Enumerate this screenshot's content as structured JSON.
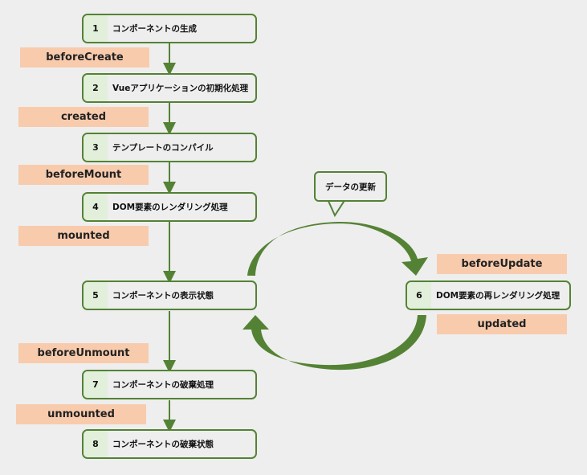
{
  "colors": {
    "border": "#548235",
    "number_bg": "#e2efda",
    "hook_bg": "#f8cbad",
    "arrow": "#548235"
  },
  "steps": [
    {
      "num": "1",
      "label": "コンポーネントの生成"
    },
    {
      "num": "2",
      "label": "Vueアプリケーションの初期化処理"
    },
    {
      "num": "3",
      "label": "テンプレートのコンパイル"
    },
    {
      "num": "4",
      "label": "DOM要素のレンダリング処理"
    },
    {
      "num": "5",
      "label": "コンポーネントの表示状態"
    },
    {
      "num": "6",
      "label": "DOM要素の再レンダリング処理"
    },
    {
      "num": "7",
      "label": "コンポーネントの破棄処理"
    },
    {
      "num": "8",
      "label": "コンポーネントの破棄状態"
    }
  ],
  "hooks": [
    "beforeCreate",
    "created",
    "beforeMount",
    "mounted",
    "beforeUpdate",
    "updated",
    "beforeUnmount",
    "unmounted"
  ],
  "bubble": "データの更新"
}
